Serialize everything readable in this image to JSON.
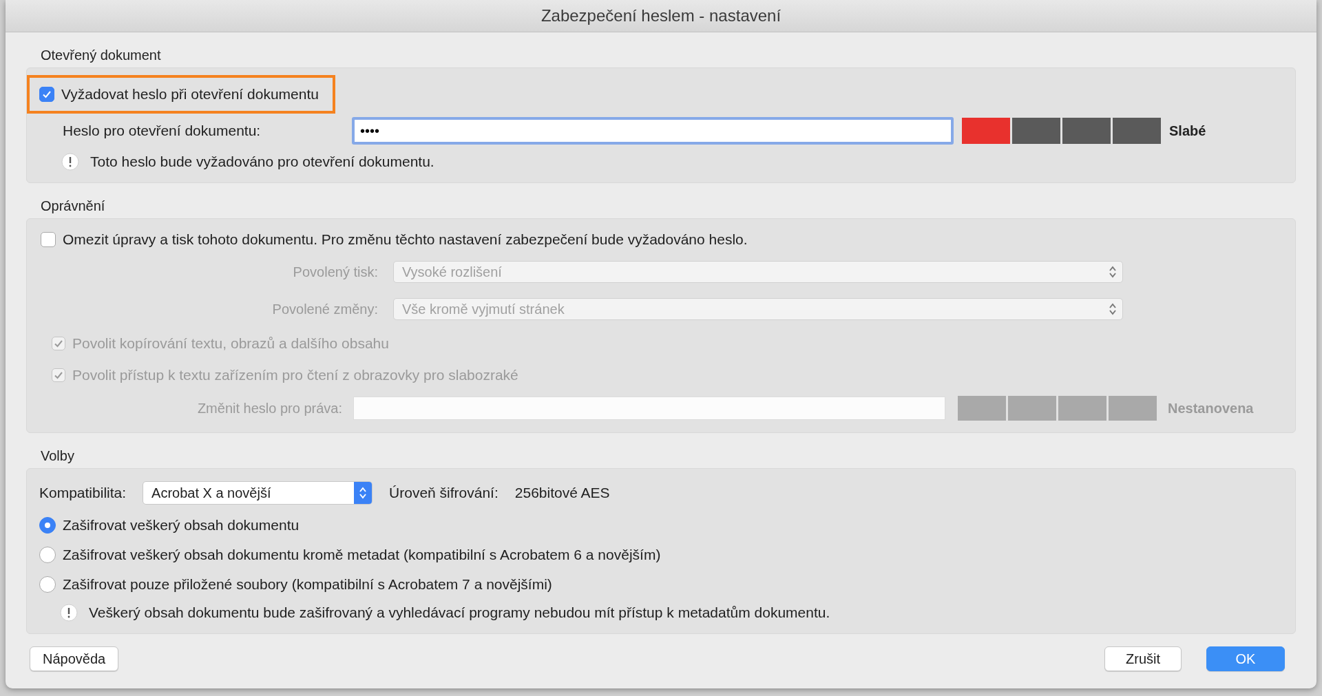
{
  "window": {
    "title": "Zabezpečení heslem - nastavení"
  },
  "open_document": {
    "heading": "Otevřený dokument",
    "require_password": {
      "label": "Vyžadovat heslo při otevření dokumentu",
      "checked": true,
      "highlighted": true
    },
    "password": {
      "label": "Heslo pro otevření dokumentu:",
      "value": "••••",
      "focused": true,
      "disabled": false
    },
    "strength": {
      "level": 0.25,
      "label": "Slabé",
      "disabled": false
    },
    "info": "Toto heslo bude vyžadováno pro otevření dokumentu."
  },
  "permissions": {
    "heading": "Oprávnění",
    "restrict": {
      "label": "Omezit úpravy a tisk tohoto dokumentu. Pro změnu těchto nastavení zabezpečení bude vyžadováno heslo.",
      "checked": false
    },
    "selects": [
      {
        "label": "Povolený tisk:",
        "value": "Vysoké rozlišení",
        "disabled": true
      },
      {
        "label": "Povolené změny:",
        "value": "Vše kromě vyjmutí stránek",
        "disabled": true
      }
    ],
    "checkboxes": [
      {
        "label": "Povolit kopírování textu, obrazů a dalšího obsahu",
        "checked": true,
        "disabled": true
      },
      {
        "label": "Povolit přístup k textu zařízením pro čtení z obrazovky pro slabozraké",
        "checked": true,
        "disabled": true
      }
    ],
    "password": {
      "label": "Změnit heslo pro práva:",
      "disabled": true
    },
    "strength": {
      "label": "Nestanovena",
      "disabled": true
    }
  },
  "options": {
    "heading": "Volby",
    "compatibility": {
      "label": "Kompatibilita:",
      "value": "Acrobat X a novější"
    },
    "encryption": {
      "label": "Úroveň šifrování:",
      "value": "256bitové AES"
    },
    "radios": [
      {
        "label": "Zašifrovat veškerý obsah dokumentu",
        "selected": true
      },
      {
        "label": "Zašifrovat veškerý obsah dokumentu kromě metadat (kompatibilní s Acrobatem 6 a novějším)",
        "selected": false
      },
      {
        "label": "Zašifrovat pouze přiložené soubory (kompatibilní s Acrobatem 7 a novějšími)",
        "selected": false
      }
    ],
    "info": "Veškerý obsah dokumentu bude zašifrovaný a vyhledávací programy nebudou mít přístup k metadatům dokumentu."
  },
  "buttons": [
    {
      "label": "Nápověda",
      "kind": "help"
    },
    {
      "label": "Zrušit",
      "kind": "cancel"
    },
    {
      "label": "OK",
      "kind": "default"
    }
  ]
}
